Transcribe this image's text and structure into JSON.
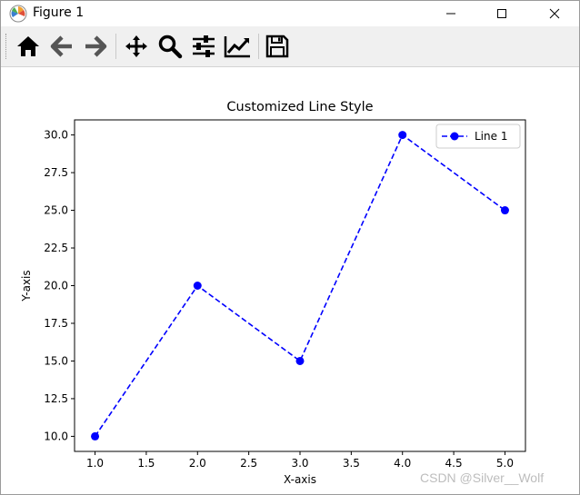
{
  "window": {
    "title": "Figure 1",
    "controls": [
      "minimize",
      "maximize",
      "close"
    ]
  },
  "toolbar": {
    "items": [
      {
        "name": "home",
        "icon": "home-icon"
      },
      {
        "name": "back",
        "icon": "arrow-left-icon"
      },
      {
        "name": "forward",
        "icon": "arrow-right-icon"
      },
      {
        "name": "pan",
        "icon": "move-icon"
      },
      {
        "name": "zoom",
        "icon": "zoom-icon"
      },
      {
        "name": "subplots",
        "icon": "sliders-icon"
      },
      {
        "name": "customize",
        "icon": "chart-edit-icon"
      },
      {
        "name": "save",
        "icon": "save-icon"
      }
    ]
  },
  "chart_data": {
    "type": "line",
    "title": "Customized Line Style",
    "xlabel": "X-axis",
    "ylabel": "Y-axis",
    "x": [
      1,
      2,
      3,
      4,
      5
    ],
    "series": [
      {
        "name": "Line 1",
        "values": [
          10,
          20,
          15,
          30,
          25
        ],
        "color": "#0000ff",
        "linestyle": "dashed",
        "marker": "circle"
      }
    ],
    "xticks": [
      "1.0",
      "1.5",
      "2.0",
      "2.5",
      "3.0",
      "3.5",
      "4.0",
      "4.5",
      "5.0"
    ],
    "yticks": [
      "10.0",
      "12.5",
      "15.0",
      "17.5",
      "20.0",
      "22.5",
      "25.0",
      "27.5",
      "30.0"
    ],
    "xlim": [
      0.8,
      5.2
    ],
    "ylim": [
      9,
      31
    ],
    "grid": false,
    "legend_position": "top-right"
  },
  "watermark": "CSDN @Silver__Wolf"
}
